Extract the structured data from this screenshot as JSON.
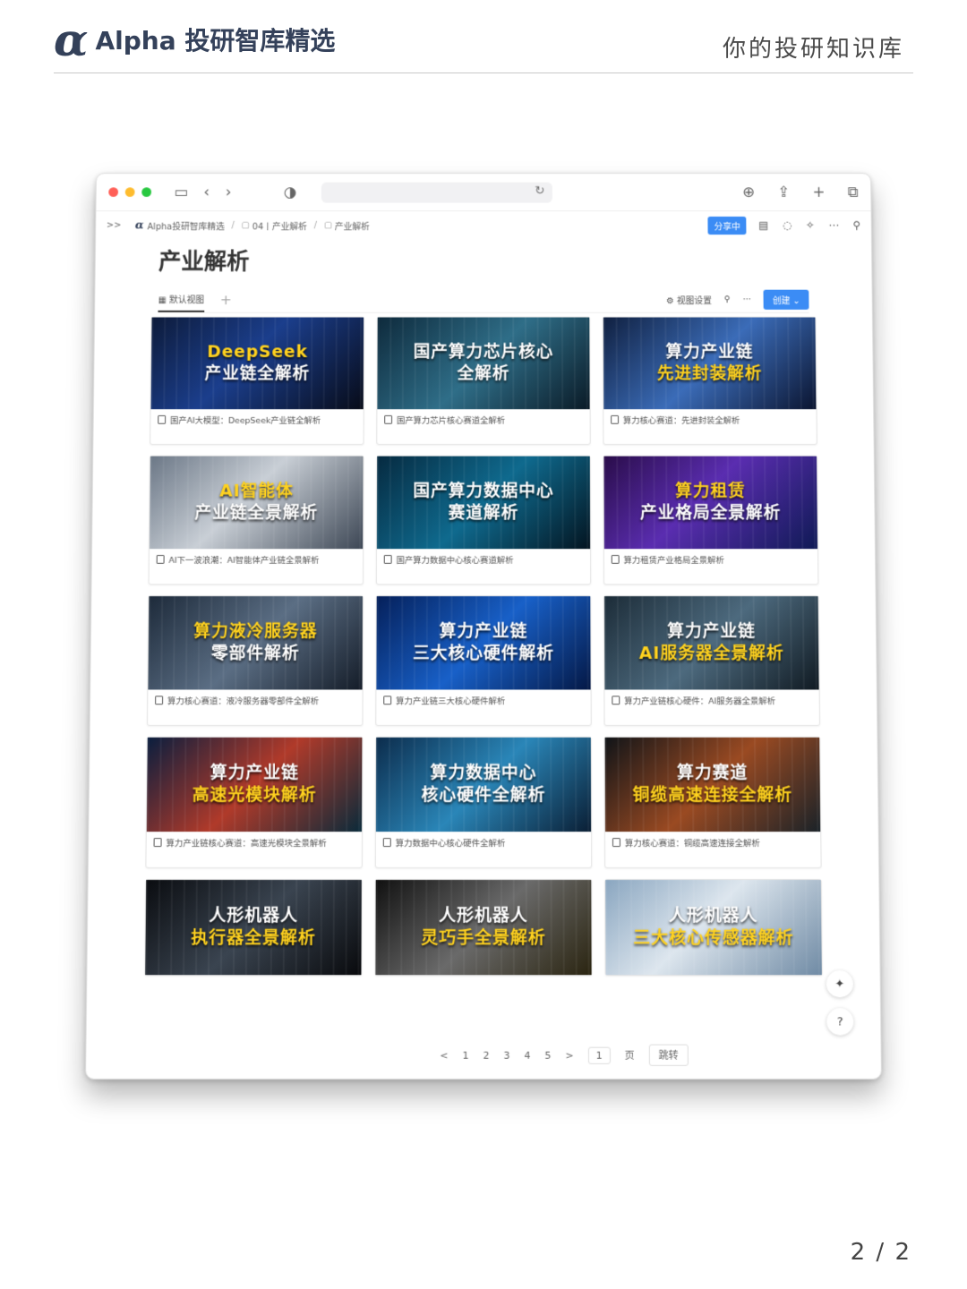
{
  "header": {
    "brand_alpha": "α",
    "brand_name": "Alpha 投研智库精选",
    "tagline": "你的投研知识库"
  },
  "browser": {
    "dot_colors": [
      "#ff5f57",
      "#febc2e",
      "#28c840"
    ],
    "icons": [
      "sidebar-icon",
      "back-icon",
      "forward-icon",
      "shield-icon",
      "reload-icon",
      "download-icon",
      "share-icon",
      "new-tab-icon",
      "tabs-icon"
    ]
  },
  "breadcrumb": {
    "expand": ">>",
    "alpha": "α",
    "items": [
      "Alpha投研智库精选",
      "04丨产业解析",
      "产业解析"
    ],
    "share_label": "分享中"
  },
  "page": {
    "title": "产业解析",
    "view_tab": "默认视图",
    "view_settings": "视图设置",
    "create_label": "创建"
  },
  "cards": [
    {
      "title_lines": [
        "DeepSeek",
        "产业链全解析"
      ],
      "gold": [
        true,
        false
      ],
      "bg": "linear-gradient(135deg,#0d1b3a 0%,#1b3e8c 45%,#070b18 100%)",
      "caption": "国产AI大模型：DeepSeek产业链全解析"
    },
    {
      "title_lines": [
        "国产算力芯片核心",
        "全解析"
      ],
      "gold": [
        false,
        false
      ],
      "bg": "linear-gradient(135deg,#0e2a3c 0%,#2f6e88 50%,#0a1a26 100%)",
      "caption": "国产算力芯片核心赛道全解析"
    },
    {
      "title_lines": [
        "算力产业链",
        "先进封装解析"
      ],
      "gold": [
        false,
        true
      ],
      "bg": "linear-gradient(135deg,#102040 0%,#3b6cb8 50%,#0b1530 100%)",
      "caption": "算力核心赛道：先进封装全解析"
    },
    {
      "title_lines": [
        "AI智能体",
        "产业链全景解析"
      ],
      "gold": [
        true,
        false
      ],
      "bg": "linear-gradient(135deg,#6b7786 0%,#c9cfd6 45%,#3c4654 100%)",
      "caption": "AI下一波浪潮：AI智能体产业链全景解析"
    },
    {
      "title_lines": [
        "国产算力数据中心",
        "赛道解析"
      ],
      "gold": [
        false,
        false
      ],
      "bg": "linear-gradient(135deg,#062a40 0%,#0f6a8e 50%,#031420 100%)",
      "caption": "国产算力数据中心核心赛道解析"
    },
    {
      "title_lines": [
        "算力租赁",
        "产业格局全景解析"
      ],
      "gold": [
        true,
        false
      ],
      "bg": "linear-gradient(135deg,#2a0d4a 0%,#5a2db0 45%,#0f1a55 100%)",
      "caption": "算力租赁产业格局全景解析"
    },
    {
      "title_lines": [
        "算力液冷服务器",
        "零部件解析"
      ],
      "gold": [
        true,
        false
      ],
      "bg": "linear-gradient(135deg,#1d2a3a 0%,#5b6e84 50%,#141c28 100%)",
      "caption": "算力核心赛道：液冷服务器零部件全解析"
    },
    {
      "title_lines": [
        "算力产业链",
        "三大核心硬件解析"
      ],
      "gold": [
        false,
        false
      ],
      "bg": "linear-gradient(135deg,#05205a 0%,#1860c8 50%,#041845 100%)",
      "caption": "算力产业链三大核心硬件解析"
    },
    {
      "title_lines": [
        "算力产业链",
        "AI服务器全景解析"
      ],
      "gold": [
        false,
        true
      ],
      "bg": "linear-gradient(135deg,#1c2c38 0%,#4d6a7e 50%,#101a22 100%)",
      "caption": "算力产业链核心硬件：AI服务器全景解析"
    },
    {
      "title_lines": [
        "算力产业链",
        "高速光模块解析"
      ],
      "gold": [
        false,
        true
      ],
      "bg": "linear-gradient(135deg,#0a1e3e 0%,#b03a2a 50%,#0a2a3a 100%)",
      "caption": "算力产业链核心赛道：高速光模块全景解析"
    },
    {
      "title_lines": [
        "算力数据中心",
        "核心硬件全解析"
      ],
      "gold": [
        false,
        false
      ],
      "bg": "linear-gradient(135deg,#0c2c4c 0%,#2a86b8 50%,#0a1e34 100%)",
      "caption": "算力数据中心核心硬件全解析"
    },
    {
      "title_lines": [
        "算力赛道",
        "铜缆高速连接全解析"
      ],
      "gold": [
        false,
        true
      ],
      "bg": "linear-gradient(135deg,#101418 0%,#9a4a22 50%,#1a2228 100%)",
      "caption": "算力核心赛道：铜缆高速连接全解析"
    },
    {
      "title_lines": [
        "人形机器人",
        "执行器全景解析"
      ],
      "gold": [
        false,
        true
      ],
      "bg": "linear-gradient(135deg,#0a0c10 0%,#3a4450 50%,#08090c 100%)",
      "caption": ""
    },
    {
      "title_lines": [
        "人形机器人",
        "灵巧手全景解析"
      ],
      "gold": [
        false,
        true
      ],
      "bg": "linear-gradient(135deg,#101010 0%,#6a6a6a 50%,#2a2410 100%)",
      "caption": ""
    },
    {
      "title_lines": [
        "人形机器人",
        "三大核心传感器解析"
      ],
      "gold": [
        false,
        true
      ],
      "bg": "linear-gradient(135deg,#8aa6c0 0%,#dde6ee 45%,#6f8aa4 100%)",
      "caption": ""
    }
  ],
  "pager": {
    "prev": "<",
    "pages": [
      "1",
      "2",
      "3",
      "4",
      "5"
    ],
    "next": ">",
    "current": "1",
    "page_word": "页",
    "jump": "跳转"
  },
  "float": {
    "sparkle": "✦",
    "help": "?"
  },
  "page_number": "2 / 2"
}
